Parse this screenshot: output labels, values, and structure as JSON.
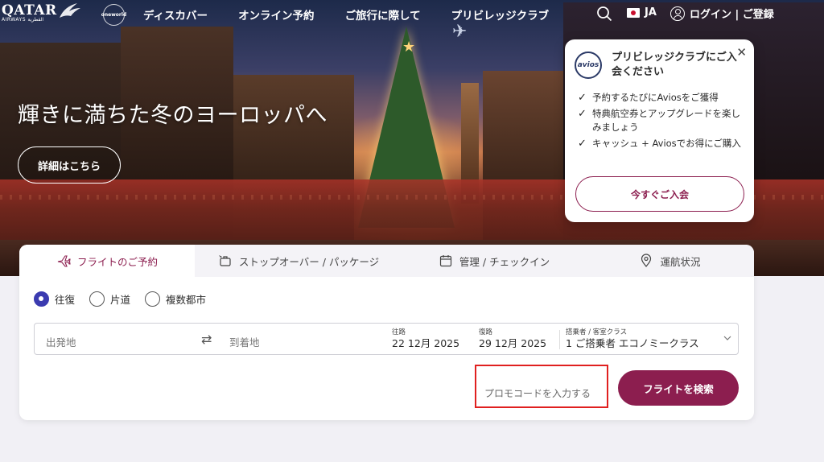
{
  "header": {
    "logo_text": "QATAR",
    "logo_sub": "AIRWAYS القطرية",
    "oneworld": "oneworld",
    "nav": [
      "ディスカバー",
      "オンライン予約",
      "ご旅行に際して",
      "プリビレッジクラブ"
    ],
    "lang": "JA",
    "login": "ログイン | ご登録"
  },
  "hero": {
    "title": "輝きに満ちた冬のヨーロッパへ",
    "cta": "詳細はこちら"
  },
  "popup": {
    "badge": "avios",
    "title": "プリビレッジクラブにご入会ください",
    "benefits": [
      "予約するたびにAviosをご獲得",
      "特典航空券とアップグレードを楽しみましょう",
      "キャッシュ + Aviosでお得にご購入"
    ],
    "join": "今すぐご入会"
  },
  "booking": {
    "tabs": [
      "フライトのご予約",
      "ストップオーバー / パッケージ",
      "管理 / チェックイン",
      "運航状況"
    ],
    "trip_types": [
      "往復",
      "片道",
      "複数都市"
    ],
    "selected_trip": "往復",
    "from_placeholder": "出発地",
    "to_placeholder": "到着地",
    "depart_label": "往路",
    "depart_value": "22 12月 2025",
    "return_label": "復路",
    "return_value": "29 12月 2025",
    "pax_label": "搭乗者 / 客室クラス",
    "pax_value": "1 ご搭乗者 エコノミークラス",
    "promo": "プロモコードを入力する",
    "search": "フライトを検索"
  },
  "colors": {
    "brand": "#8c1e4f",
    "radio": "#3b3bb0",
    "highlight": "#e0201f"
  }
}
